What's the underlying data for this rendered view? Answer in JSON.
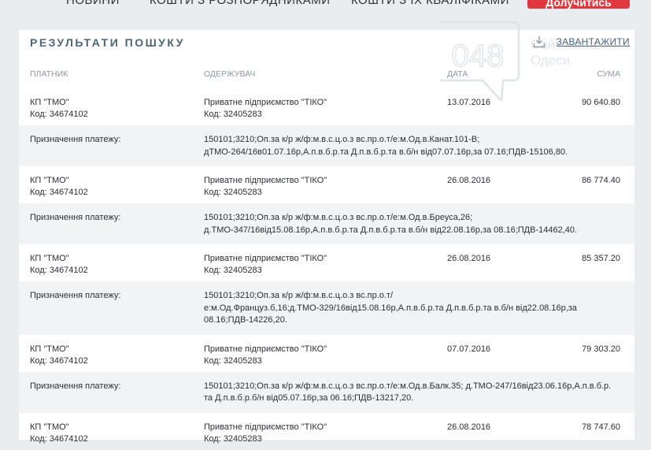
{
  "nav": {
    "items": [
      "Новини",
      "Кошти з розпорядниками",
      "Кошти з їх кваліфіками"
    ],
    "cta_label": "Долучитись"
  },
  "section": {
    "title": "РЕЗУЛЬТАТИ ПОШУКУ",
    "download_label": "ЗАВАНТАЖИТИ"
  },
  "watermark": {
    "number": "048",
    "line1": "Сайт міста",
    "line2": "Одеси"
  },
  "table": {
    "headers": {
      "payer": "ПЛАТНИК",
      "recipient": "ОДЕРЖУВАЧ",
      "date": "ДАТА",
      "sum": "СУМА"
    },
    "purpose_label": "Призначення платежу:",
    "rows": [
      {
        "payer_name": "КП \"ТМО\"",
        "payer_code": "Код: 34674102",
        "recipient_name": "Приватне підприємство \"ТІКО\"",
        "recipient_code": "Код: 32405283",
        "date": "13.07.2016",
        "sum": "90 640.80",
        "purpose": "150101;3210;Оп.за к/р ж/ф:м.в.с.ц.о.з вс.пр.о.т/е:м.Од.в.Канат.101-В; дТМО-264/16в01.07.16р,А.п.в.б.р.та Д.п.в.б.р.та в.б/н від07.07.16р,за 07.16;ПДВ-15106,80."
      },
      {
        "payer_name": "КП \"ТМО\"",
        "payer_code": "Код: 34674102",
        "recipient_name": "Приватне підприємство \"ТІКО\"",
        "recipient_code": "Код: 32405283",
        "date": "26.08.2016",
        "sum": "86 774.40",
        "purpose": "150101;3210;Оп.за к/р ж/ф:м.в.с.ц.о.з вс.пр.о.т/е:м.Од.в.Бреуса,26; д.ТМО-347/16від15.08.16р,А.п.в.б.р.та Д.п.в.б.р.та в.б/н від22.08.16р,за 08.16;ПДВ-14462,40."
      },
      {
        "payer_name": "КП \"ТМО\"",
        "payer_code": "Код: 34674102",
        "recipient_name": "Приватне підприємство \"ТІКО\"",
        "recipient_code": "Код: 32405283",
        "date": "26.08.2016",
        "sum": "85 357.20",
        "purpose": "150101;3210;Оп.за к/р ж/ф:м.в.с.ц.о.з вс.пр.о.т/ е:м.Од.Француз.б,16;д.ТМО-329/16від15.08.16р,А.п.в.б.р.та Д.п.в.б.р.та в.б/н від22.08.16р,за 08.16;ПДВ-14226,20."
      },
      {
        "payer_name": "КП \"ТМО\"",
        "payer_code": "Код: 34674102",
        "recipient_name": "Приватне підприємство \"ТІКО\"",
        "recipient_code": "Код: 32405283",
        "date": "07.07.2016",
        "sum": "79 303.20",
        "purpose": "150101;3210;Оп.за к/р ж/ф:м.в.с.ц.о.з вс.пр.о.т/е:м.Од.в.Балк.35; д.ТМО-247/16від23.06.16р,А.п.в.б.р. та Д.п.в.б.р.б/н від05.07.16р,за 06.16;ПДВ-13217,20."
      },
      {
        "payer_name": "КП \"ТМО\"",
        "payer_code": "Код: 34674102",
        "recipient_name": "Приватне підприємство \"ТІКО\"",
        "recipient_code": "Код: 32405283",
        "date": "26.08.2016",
        "sum": "78 747.60"
      }
    ]
  },
  "colors": {
    "accent": "#e0383e",
    "heading": "#4b6478",
    "stripe": "#f1f3f5",
    "page_bg": "#e9edf0"
  }
}
